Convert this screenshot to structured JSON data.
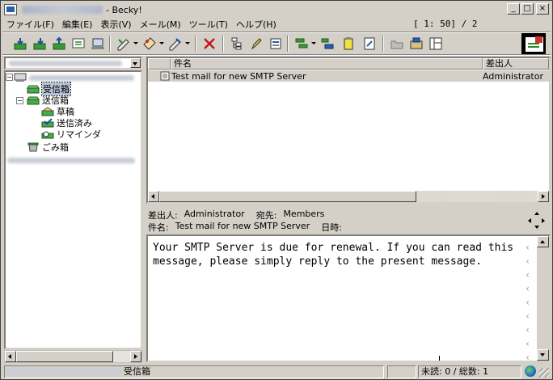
{
  "window": {
    "title": "- Becky!",
    "minimize_glyph": "_",
    "maximize_glyph": "□",
    "close_glyph": "×"
  },
  "menu": {
    "items": [
      "ファイル(F)",
      "編集(E)",
      "表示(V)",
      "メール(M)",
      "ツール(T)",
      "ヘルプ(H)"
    ],
    "page_indicator": "[    1:  50] / 2"
  },
  "toolbar": {
    "icons": [
      "receive-all-icon",
      "receive-icon",
      "send-icon",
      "sync-icon",
      "offline-icon",
      "compose-icon",
      "reply-icon",
      "forward-icon",
      "delete-icon",
      "thread-icon",
      "edit-icon",
      "properties-icon",
      "filter-icon",
      "sort-icon",
      "note-icon",
      "template-icon",
      "folder-icon",
      "mailbox-icon",
      "layout-icon",
      "new-message-icon"
    ]
  },
  "tree": {
    "nodes": [
      {
        "label": "受信箱",
        "selected": true
      },
      {
        "label": "送信箱",
        "selected": false
      },
      {
        "label": "草稿",
        "selected": false
      },
      {
        "label": "送信済み",
        "selected": false
      },
      {
        "label": "リマインダ",
        "selected": false
      },
      {
        "label": "ごみ箱",
        "selected": false
      }
    ]
  },
  "list": {
    "columns": [
      "件名",
      "差出人"
    ],
    "rows": [
      {
        "subject": "Test mail for new SMTP Server",
        "sender": "Administrator"
      }
    ]
  },
  "header": {
    "from_label": "差出人:",
    "from_value": "Administrator",
    "to_label": "宛先:",
    "to_value": "Members",
    "subject_label": "件名:",
    "subject_value": "Test mail for new SMTP Server",
    "date_label": "日時:"
  },
  "body": {
    "line1": "Your SMTP Server is due for renewal. If you can read this",
    "line2": "message, please simply reply to the present message."
  },
  "status": {
    "folder": "受信箱",
    "counts": "未読:   0 / 総数:   1"
  },
  "colors": {
    "face": "#d4d0c8",
    "selection": "#b8c4d8"
  }
}
